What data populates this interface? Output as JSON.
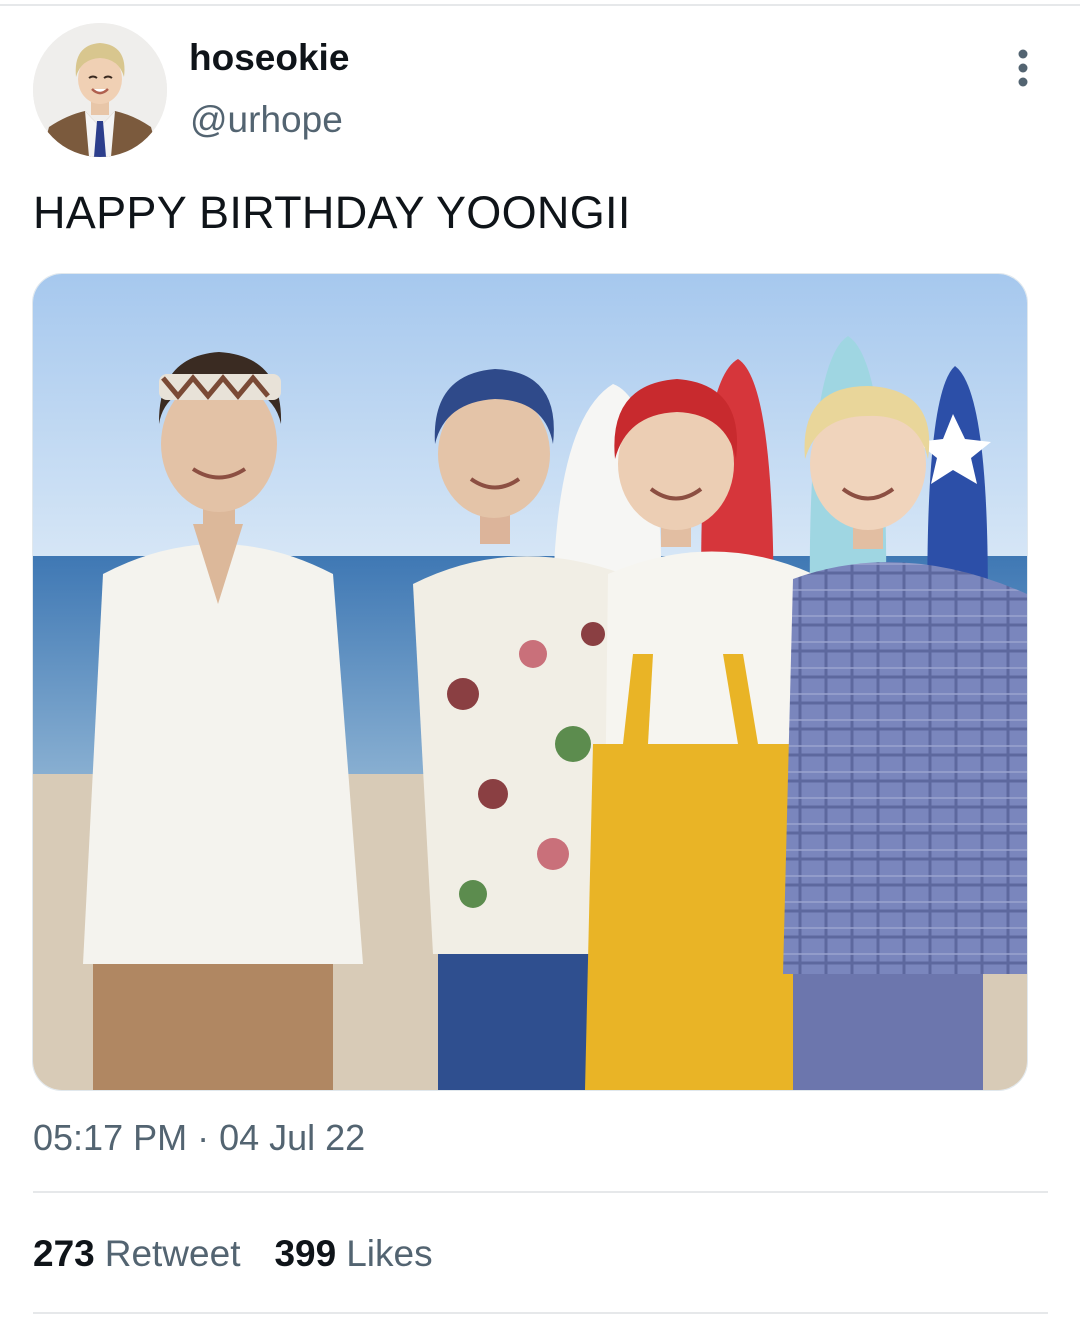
{
  "tweet": {
    "author": {
      "display_name": "hoseokie",
      "handle": "@urhope"
    },
    "text": "HAPPY BIRTHDAY YOONGII",
    "timestamp": "05:17 PM · 04 Jul 22",
    "stats": {
      "retweets": {
        "count": "273",
        "label": "Retweet"
      },
      "likes": {
        "count": "399",
        "label": "Likes"
      }
    }
  },
  "icons": {
    "more": "more-vertical-icon"
  },
  "colors": {
    "text": "#0f1419",
    "secondary_text": "#536471",
    "divider": "#e6e8ea"
  }
}
